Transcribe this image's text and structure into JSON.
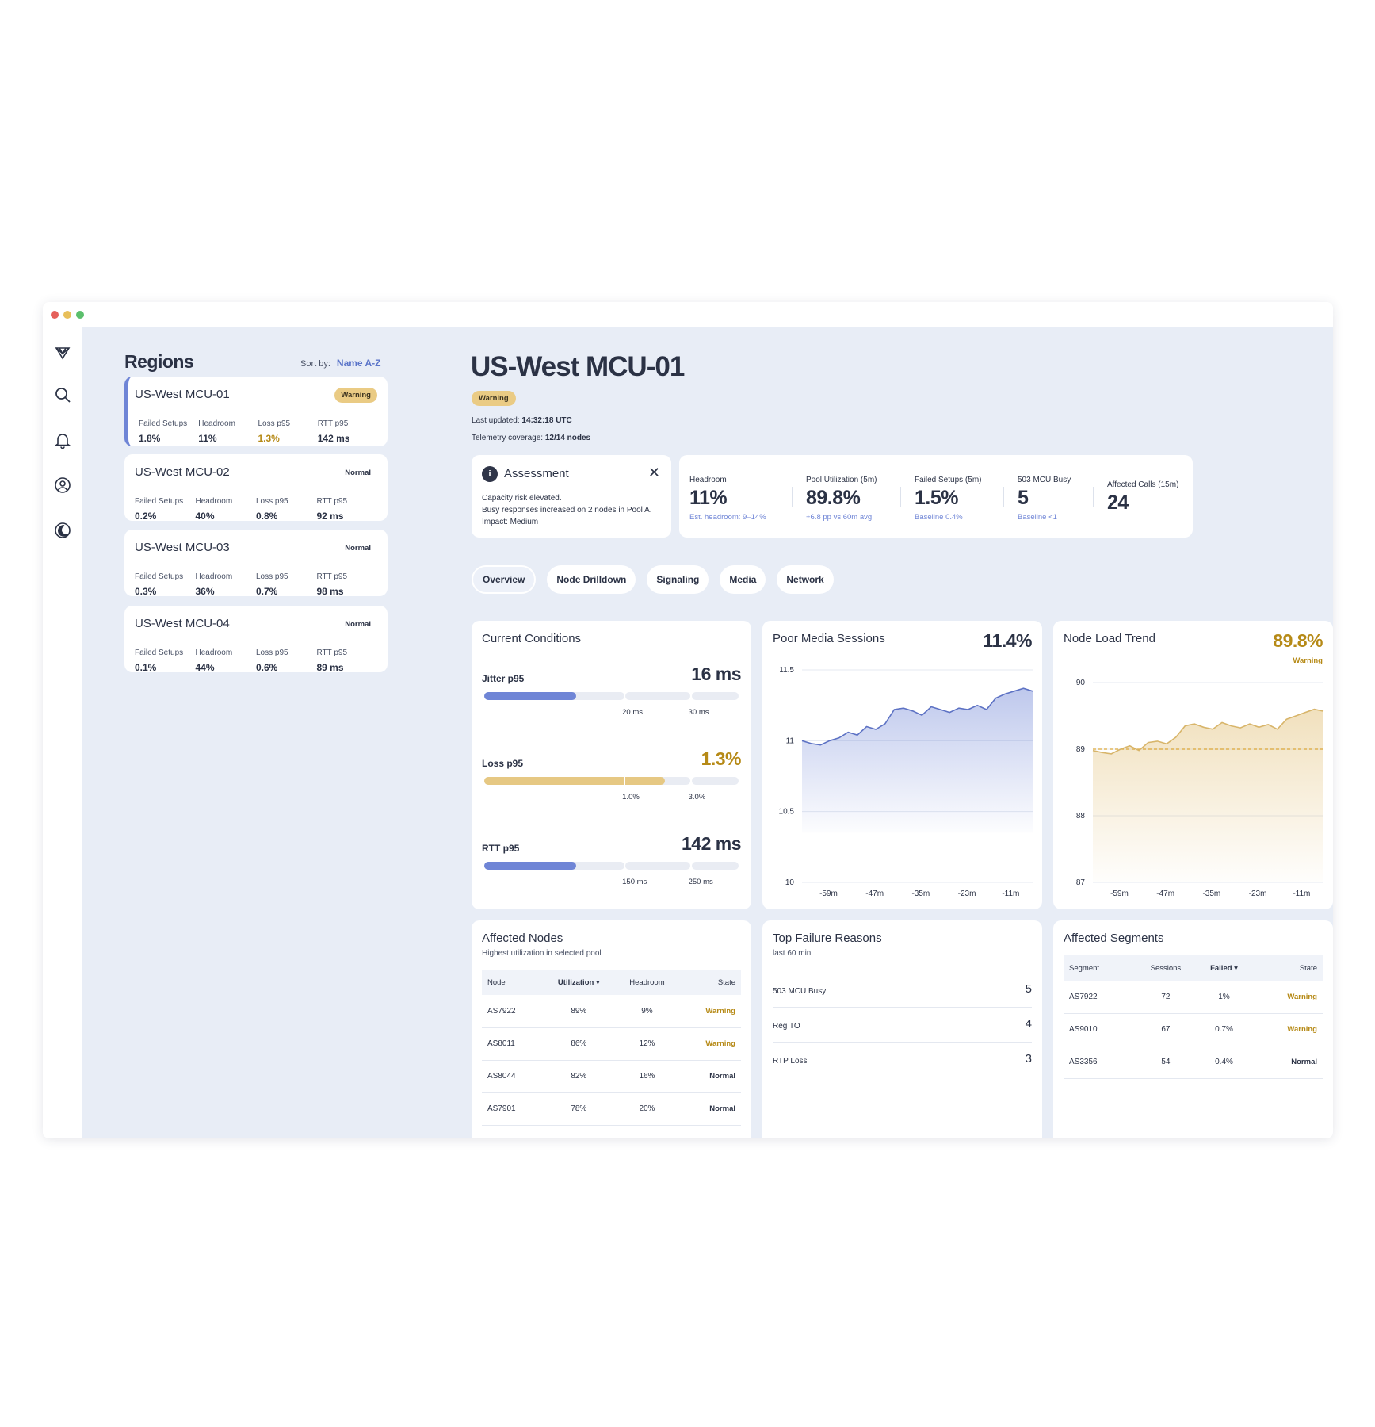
{
  "sidebar": {
    "icons": [
      "logo-icon",
      "search-icon",
      "bell-icon",
      "user-circle-icon",
      "moon-icon"
    ]
  },
  "regions": {
    "title": "Regions",
    "sort_label": "Sort by:",
    "sort_value": "Name A-Z",
    "stat_labels": [
      "Failed Setups",
      "Headroom",
      "Loss p95",
      "RTT p95"
    ],
    "items": [
      {
        "name": "US-West MCU-01",
        "status": "Warning",
        "failed_setups": "1.8%",
        "headroom": "11%",
        "loss_p95": "1.3%",
        "rtt_p95": "142 ms"
      },
      {
        "name": "US-West MCU-02",
        "status": "Normal",
        "failed_setups": "0.2%",
        "headroom": "40%",
        "loss_p95": "0.8%",
        "rtt_p95": "92 ms"
      },
      {
        "name": "US-West MCU-03",
        "status": "Normal",
        "failed_setups": "0.3%",
        "headroom": "36%",
        "loss_p95": "0.7%",
        "rtt_p95": "98 ms"
      },
      {
        "name": "US-West MCU-04",
        "status": "Normal",
        "failed_setups": "0.1%",
        "headroom": "44%",
        "loss_p95": "0.6%",
        "rtt_p95": "89 ms"
      }
    ]
  },
  "header": {
    "title": "US-West MCU-01",
    "status": "Warning",
    "last_updated_label": "Last updated:",
    "last_updated_value": "14:32:18 UTC",
    "coverage_label": "Telemetry coverage:",
    "coverage_value": "12/14 nodes"
  },
  "assessment": {
    "title": "Assessment",
    "icon_text": "i",
    "lines": [
      "Capacity risk elevated.",
      "Busy responses increased on 2 nodes in Pool A.",
      "Impact: Medium"
    ]
  },
  "kpis": [
    {
      "label": "Headroom",
      "value": "11%",
      "sub": "Est. headroom: 9–14%"
    },
    {
      "label": "Pool Utilization (5m)",
      "value": "89.8%",
      "sub": "+6.8 pp vs 60m avg"
    },
    {
      "label": "Failed Setups (5m)",
      "value": "1.5%",
      "sub": "Baseline 0.4%"
    },
    {
      "label": "503 MCU Busy",
      "value": "5",
      "sub": "Baseline <1"
    },
    {
      "label": "Affected Calls (15m)",
      "value": "24",
      "sub": ""
    }
  ],
  "tabs": [
    "Overview",
    "Node Drilldown",
    "Signaling",
    "Media",
    "Network"
  ],
  "active_tab": "Overview",
  "conditions": {
    "title": "Current Conditions",
    "rows": [
      {
        "label": "Jitter p95",
        "value": "16 ms",
        "fill": 0.36,
        "ticks": [
          "20 ms",
          "30 ms"
        ],
        "color": "#6f85d6",
        "warn": false
      },
      {
        "label": "Loss p95",
        "value": "1.3%",
        "fill": 0.71,
        "ticks": [
          "1.0%",
          "3.0%"
        ],
        "color": "#e6c883",
        "warn": true
      },
      {
        "label": "RTT p95",
        "value": "142 ms",
        "fill": 0.36,
        "ticks": [
          "150 ms",
          "250 ms"
        ],
        "color": "#6f85d6",
        "warn": false
      }
    ]
  },
  "chart_data": [
    {
      "type": "area",
      "title": "Poor Media Sessions",
      "current_value": "11.4%",
      "ylim": [
        10,
        11.5
      ],
      "y_ticks": [
        "11.5",
        "11",
        "10.5",
        "10"
      ],
      "x_ticks": [
        "-59m",
        "-47m",
        "-35m",
        "-23m",
        "-11m"
      ],
      "color": "#6f85d6",
      "values": [
        11.0,
        10.98,
        10.97,
        11.0,
        11.02,
        11.06,
        11.04,
        11.1,
        11.08,
        11.12,
        11.22,
        11.23,
        11.21,
        11.18,
        11.24,
        11.22,
        11.2,
        11.23,
        11.22,
        11.25,
        11.22,
        11.3,
        11.33,
        11.35,
        11.37,
        11.35
      ]
    },
    {
      "type": "area",
      "title": "Node Load Trend",
      "current_value": "89.8%",
      "status": "Warning",
      "ylim": [
        87,
        90.3
      ],
      "y_ticks": [
        "90",
        "89",
        "88",
        "87"
      ],
      "x_ticks": [
        "-59m",
        "-47m",
        "-35m",
        "-23m",
        "-11m"
      ],
      "baseline": 89.0,
      "color": "#e0bb6d",
      "values": [
        88.98,
        88.95,
        88.93,
        89.0,
        89.05,
        88.98,
        89.1,
        89.12,
        89.08,
        89.18,
        89.35,
        89.38,
        89.33,
        89.3,
        89.4,
        89.35,
        89.32,
        89.38,
        89.33,
        89.37,
        89.3,
        89.45,
        89.5,
        89.55,
        89.6,
        89.57
      ]
    }
  ],
  "affected_nodes": {
    "title": "Affected Nodes",
    "subtitle": "Highest utilization in selected pool",
    "columns": [
      "Node",
      "Utilization ▾",
      "Headroom",
      "State"
    ],
    "rows": [
      {
        "node": "AS7922",
        "utilization": "89%",
        "headroom": "9%",
        "state": "Warning"
      },
      {
        "node": "AS8011",
        "utilization": "86%",
        "headroom": "12%",
        "state": "Warning"
      },
      {
        "node": "AS8044",
        "utilization": "82%",
        "headroom": "16%",
        "state": "Normal"
      },
      {
        "node": "AS7901",
        "utilization": "78%",
        "headroom": "20%",
        "state": "Normal"
      }
    ]
  },
  "failure_reasons": {
    "title": "Top Failure Reasons",
    "subtitle": "last 60 min",
    "items": [
      {
        "label": "503 MCU Busy",
        "count": "5"
      },
      {
        "label": "Reg TO",
        "count": "4"
      },
      {
        "label": "RTP Loss",
        "count": "3"
      }
    ]
  },
  "affected_segments": {
    "title": "Affected Segments",
    "columns": [
      "Segment",
      "Sessions",
      "Failed ▾",
      "State"
    ],
    "rows": [
      {
        "segment": "AS7922",
        "sessions": "72",
        "failed": "1%",
        "state": "Warning"
      },
      {
        "segment": "AS9010",
        "sessions": "67",
        "failed": "0.7%",
        "state": "Warning"
      },
      {
        "segment": "AS3356",
        "sessions": "54",
        "failed": "0.4%",
        "state": "Normal"
      }
    ]
  }
}
